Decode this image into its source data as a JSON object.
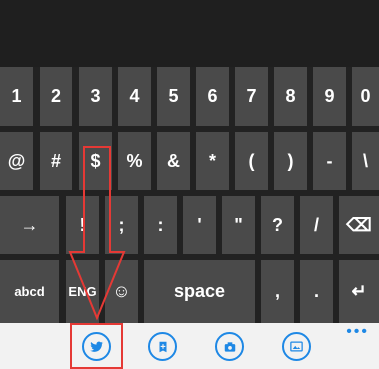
{
  "keyboard": {
    "row1": [
      "1",
      "2",
      "3",
      "4",
      "5",
      "6",
      "7",
      "8",
      "9",
      "0"
    ],
    "row2": [
      "@",
      "#",
      "$",
      "%",
      "&",
      "*",
      "(",
      ")",
      "-",
      "\\"
    ],
    "row3": [
      "→",
      "!",
      ";",
      ":",
      "'",
      "\"",
      "?",
      "/",
      "⌫"
    ],
    "row4": {
      "abcd": "abcd",
      "lang": "ENG",
      "emoji": "☺",
      "space": "space",
      "comma": ",",
      "period": ".",
      "enter": "↵"
    }
  },
  "bottom_bar": {
    "more": "•••",
    "accent": "#1e88e5",
    "icons": [
      "twitter-icon",
      "photo-edit-icon",
      "camera-icon",
      "photo-gallery-icon"
    ]
  },
  "annotation_colors": {
    "arrow": "#e53935"
  }
}
